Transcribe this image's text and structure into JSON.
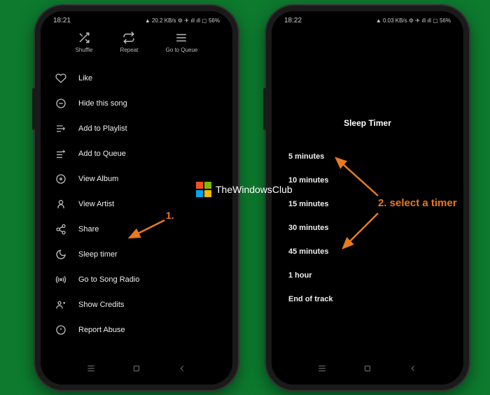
{
  "phone1": {
    "status": {
      "time": "18:21",
      "right": "▲ 20.2 KB/s ⚙ ✈ ıll ıll ▢ 56%"
    },
    "toolbar": [
      {
        "label": "Shuffle",
        "icon": "shuffle-icon"
      },
      {
        "label": "Repeat",
        "icon": "repeat-icon"
      },
      {
        "label": "Go to Queue",
        "icon": "queue-icon"
      }
    ],
    "menu": [
      {
        "label": "Like",
        "icon": "heart-icon"
      },
      {
        "label": "Hide this song",
        "icon": "hide-icon"
      },
      {
        "label": "Add to Playlist",
        "icon": "add-playlist-icon"
      },
      {
        "label": "Add to Queue",
        "icon": "add-queue-icon"
      },
      {
        "label": "View Album",
        "icon": "album-icon"
      },
      {
        "label": "View Artist",
        "icon": "artist-icon"
      },
      {
        "label": "Share",
        "icon": "share-icon"
      },
      {
        "label": "Sleep timer",
        "icon": "moon-icon"
      },
      {
        "label": "Go to Song Radio",
        "icon": "radio-icon"
      },
      {
        "label": "Show Credits",
        "icon": "credits-icon"
      },
      {
        "label": "Report Abuse",
        "icon": "report-icon"
      }
    ]
  },
  "phone2": {
    "status": {
      "time": "18:22",
      "right": "▲ 0.03 KB/s ⚙ ✈ ıll ıll ▢ 56%"
    },
    "sleep": {
      "title": "Sleep Timer",
      "options": [
        "5 minutes",
        "10 minutes",
        "15 minutes",
        "30 minutes",
        "45 minutes",
        "1 hour",
        "End of track"
      ]
    }
  },
  "annotations": {
    "step1": "1.",
    "step2": "2. select a timer"
  },
  "watermark": "TheWindowsClub"
}
